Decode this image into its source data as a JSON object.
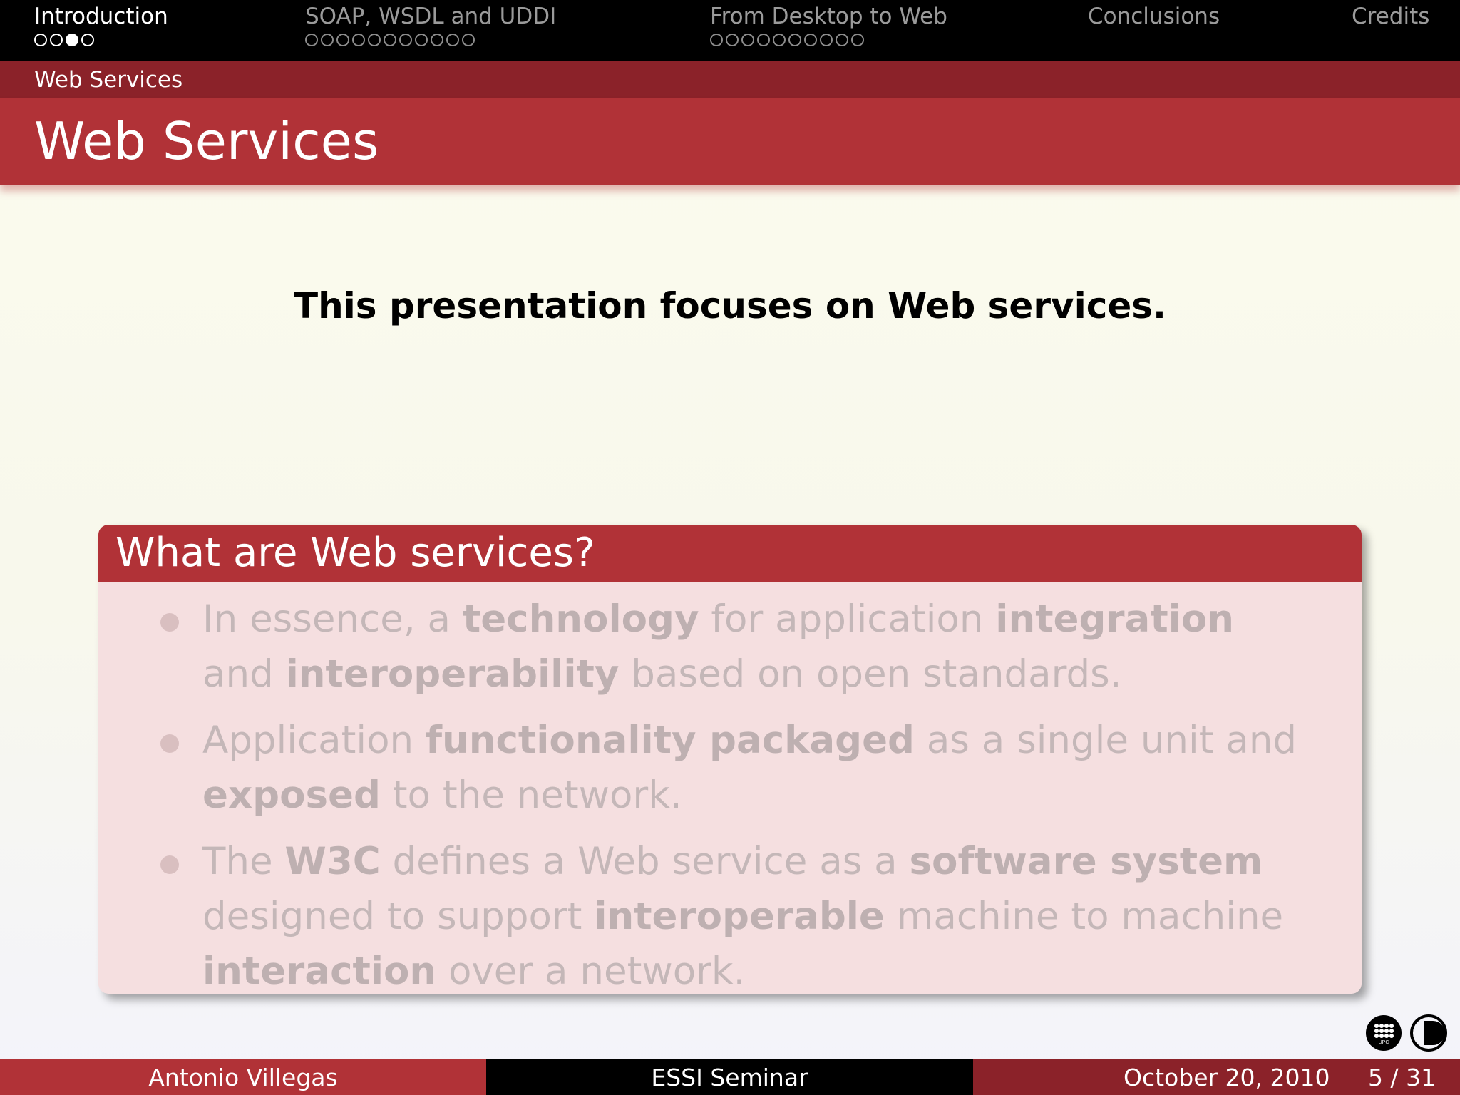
{
  "nav": {
    "sections": [
      {
        "label": "Introduction",
        "dots": 4,
        "filled_index": 2
      },
      {
        "label": "SOAP, WSDL and UDDI",
        "dots": 11,
        "filled_index": -1
      },
      {
        "label": "From Desktop to Web",
        "dots": 10,
        "filled_index": -1
      },
      {
        "label": "Conclusions",
        "dots": 0,
        "filled_index": -1
      },
      {
        "label": "Credits",
        "dots": 0,
        "filled_index": -1
      }
    ],
    "active_index": 0
  },
  "subsection": "Web Services",
  "frame_title": "Web Services",
  "intro_sentence": "This presentation focuses on Web services.",
  "block": {
    "title": "What are Web services?",
    "bullets": [
      [
        {
          "t": "In essence, a ",
          "b": false
        },
        {
          "t": "technology",
          "b": true
        },
        {
          "t": " for application ",
          "b": false
        },
        {
          "t": "integration",
          "b": true
        },
        {
          "t": " and ",
          "b": false
        },
        {
          "t": "interoperability",
          "b": true
        },
        {
          "t": " based on open standards.",
          "b": false
        }
      ],
      [
        {
          "t": "Application ",
          "b": false
        },
        {
          "t": "functionality packaged",
          "b": true
        },
        {
          "t": " as a single unit and ",
          "b": false
        },
        {
          "t": "exposed",
          "b": true
        },
        {
          "t": " to the network.",
          "b": false
        }
      ],
      [
        {
          "t": "The ",
          "b": false
        },
        {
          "t": "W3C",
          "b": true
        },
        {
          "t": " defines a Web service as a ",
          "b": false
        },
        {
          "t": "software system",
          "b": true
        },
        {
          "t": " designed to support ",
          "b": false
        },
        {
          "t": "interoperable",
          "b": true
        },
        {
          "t": " machine to machine ",
          "b": false
        },
        {
          "t": "interaction",
          "b": true
        },
        {
          "t": " over a network.",
          "b": false
        }
      ]
    ]
  },
  "logos": {
    "left": "UPC",
    "right": "DOCTORATE"
  },
  "footer": {
    "author": "Antonio Villegas",
    "event": "ESSI Seminar",
    "date": "October 20, 2010",
    "page": "5 / 31"
  },
  "colors": {
    "accent": "#b13237",
    "accent_dark": "#8b2229",
    "nav_bg": "#000000",
    "block_body": "#f5dfe0"
  }
}
